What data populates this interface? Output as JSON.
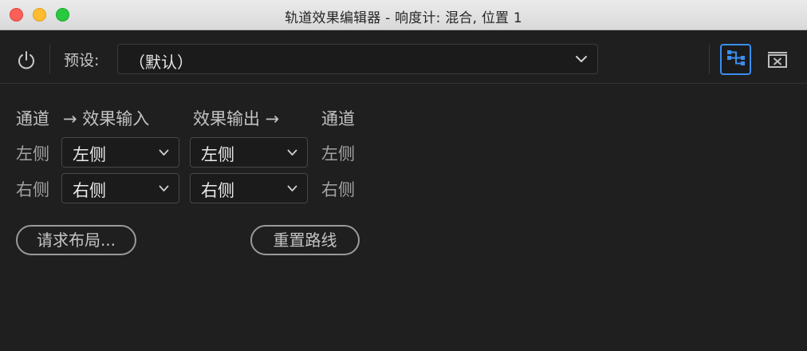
{
  "window": {
    "title": "轨道效果编辑器 - 响度计: 混合,  位置 1"
  },
  "toolbar": {
    "power_icon": "power-icon",
    "preset_label": "预设:",
    "preset_value": "（默认）",
    "routing_icon": "routing-icon",
    "close_icon": "close-panel-icon"
  },
  "routing": {
    "headers": {
      "channel_in": "通道",
      "effect_input": "→ 效果输入",
      "effect_output": "效果输出 →",
      "channel_out": "通道"
    },
    "rows": [
      {
        "left_label": "左侧",
        "input_value": "左侧",
        "output_value": "左侧",
        "right_label": "左侧"
      },
      {
        "left_label": "右侧",
        "input_value": "右侧",
        "output_value": "右侧",
        "right_label": "右侧"
      }
    ]
  },
  "actions": {
    "request_layout": "请求布局...",
    "reset_routing": "重置路线"
  },
  "colors": {
    "accent": "#3a8ef0",
    "background": "#1f1f1f"
  }
}
